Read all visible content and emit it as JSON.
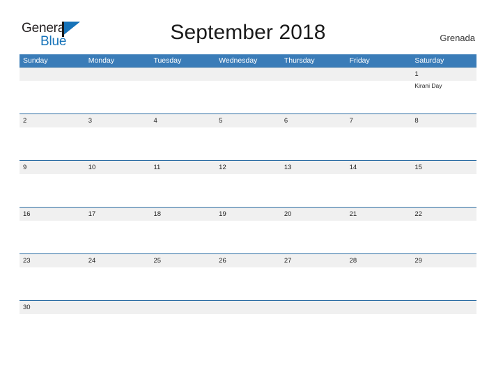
{
  "brand": {
    "name_part1": "General",
    "name_part2": "Blue",
    "flag_icon": "flag-triangle-icon",
    "color_dark": "#231f20",
    "color_blue": "#1673b9"
  },
  "header": {
    "title": "September 2018",
    "country": "Grenada"
  },
  "theme": {
    "header_blue": "#3a7cb8",
    "row_border_blue": "#2b6ca3",
    "band_gray": "#f0f0f0",
    "text_dark": "#222222"
  },
  "calendar": {
    "weekday_headers": [
      "Sunday",
      "Monday",
      "Tuesday",
      "Wednesday",
      "Thursday",
      "Friday",
      "Saturday"
    ],
    "weeks": [
      [
        {
          "day": "",
          "event": ""
        },
        {
          "day": "",
          "event": ""
        },
        {
          "day": "",
          "event": ""
        },
        {
          "day": "",
          "event": ""
        },
        {
          "day": "",
          "event": ""
        },
        {
          "day": "",
          "event": ""
        },
        {
          "day": "1",
          "event": "Kirani Day"
        }
      ],
      [
        {
          "day": "2",
          "event": ""
        },
        {
          "day": "3",
          "event": ""
        },
        {
          "day": "4",
          "event": ""
        },
        {
          "day": "5",
          "event": ""
        },
        {
          "day": "6",
          "event": ""
        },
        {
          "day": "7",
          "event": ""
        },
        {
          "day": "8",
          "event": ""
        }
      ],
      [
        {
          "day": "9",
          "event": ""
        },
        {
          "day": "10",
          "event": ""
        },
        {
          "day": "11",
          "event": ""
        },
        {
          "day": "12",
          "event": ""
        },
        {
          "day": "13",
          "event": ""
        },
        {
          "day": "14",
          "event": ""
        },
        {
          "day": "15",
          "event": ""
        }
      ],
      [
        {
          "day": "16",
          "event": ""
        },
        {
          "day": "17",
          "event": ""
        },
        {
          "day": "18",
          "event": ""
        },
        {
          "day": "19",
          "event": ""
        },
        {
          "day": "20",
          "event": ""
        },
        {
          "day": "21",
          "event": ""
        },
        {
          "day": "22",
          "event": ""
        }
      ],
      [
        {
          "day": "23",
          "event": ""
        },
        {
          "day": "24",
          "event": ""
        },
        {
          "day": "25",
          "event": ""
        },
        {
          "day": "26",
          "event": ""
        },
        {
          "day": "27",
          "event": ""
        },
        {
          "day": "28",
          "event": ""
        },
        {
          "day": "29",
          "event": ""
        }
      ],
      [
        {
          "day": "30",
          "event": ""
        },
        {
          "day": "",
          "event": ""
        },
        {
          "day": "",
          "event": ""
        },
        {
          "day": "",
          "event": ""
        },
        {
          "day": "",
          "event": ""
        },
        {
          "day": "",
          "event": ""
        },
        {
          "day": "",
          "event": ""
        }
      ]
    ]
  }
}
